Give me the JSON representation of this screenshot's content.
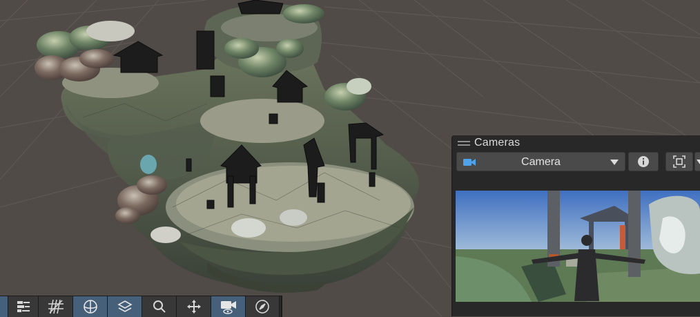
{
  "cameras_overlay": {
    "title": "Cameras",
    "selected_camera": "Camera",
    "accent_color": "#4fa3e8"
  },
  "toolbar": {
    "buttons": [
      {
        "icon": "partial-left-icon",
        "active": true
      },
      {
        "icon": "sliders-panel-icon",
        "active": false
      },
      {
        "icon": "grid-hash-icon",
        "active": false
      },
      {
        "icon": "globe-orientation-icon",
        "active": true
      },
      {
        "icon": "layer-stack-icon",
        "active": true
      },
      {
        "icon": "search-icon",
        "active": false
      },
      {
        "icon": "move-gizmo-icon",
        "active": false
      },
      {
        "icon": "camera-view-icon",
        "active": true
      },
      {
        "icon": "compass-icon",
        "active": false
      }
    ]
  }
}
